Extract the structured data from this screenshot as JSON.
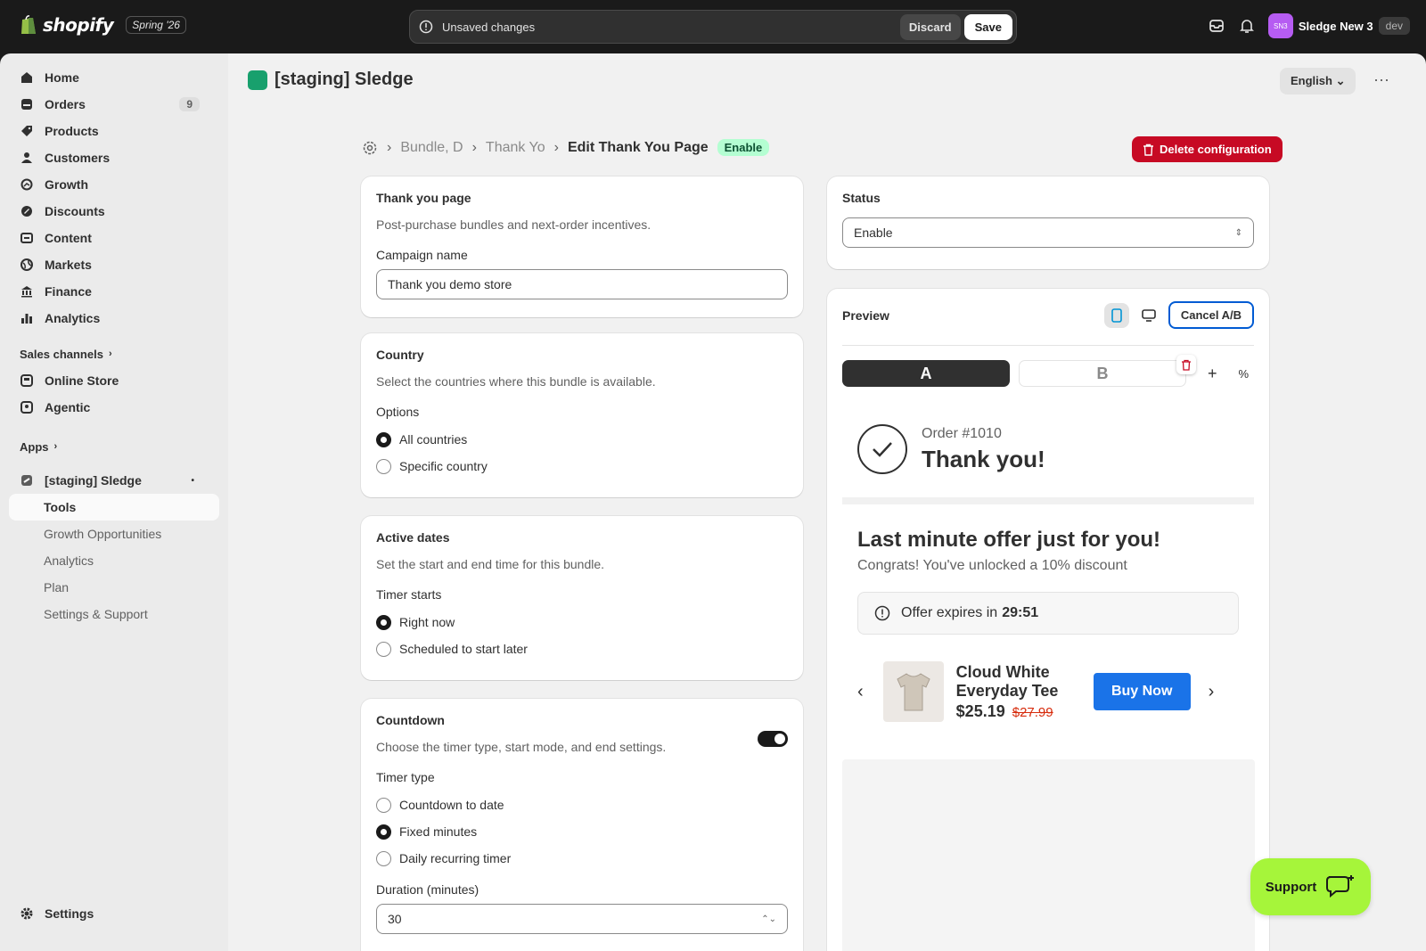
{
  "topbar": {
    "brand": "shopify",
    "edition": "Spring '26",
    "unsaved_text": "Unsaved changes",
    "discard_label": "Discard",
    "save_label": "Save",
    "avatar_initials": "SN3",
    "store_name": "Sledge New 3",
    "env_badge": "dev"
  },
  "sidebar": {
    "items": [
      {
        "label": "Home",
        "icon": "home-icon"
      },
      {
        "label": "Orders",
        "icon": "orders-icon",
        "badge": "9"
      },
      {
        "label": "Products",
        "icon": "tag-icon"
      },
      {
        "label": "Customers",
        "icon": "person-icon"
      },
      {
        "label": "Growth",
        "icon": "growth-icon"
      },
      {
        "label": "Discounts",
        "icon": "discount-icon"
      },
      {
        "label": "Content",
        "icon": "content-icon"
      },
      {
        "label": "Markets",
        "icon": "globe-icon"
      },
      {
        "label": "Finance",
        "icon": "bank-icon"
      },
      {
        "label": "Analytics",
        "icon": "bar-chart-icon"
      }
    ],
    "sales_channels_label": "Sales channels",
    "channels": [
      {
        "label": "Online Store",
        "icon": "store-icon"
      },
      {
        "label": "Agentic",
        "icon": "agentic-icon"
      }
    ],
    "apps_label": "Apps",
    "app_name": "[staging] Sledge",
    "app_subitems": [
      "Tools",
      "Growth Opportunities",
      "Analytics",
      "Plan",
      "Settings & Support"
    ],
    "settings_label": "Settings"
  },
  "header": {
    "app_title": "[staging] Sledge",
    "language": "English"
  },
  "breadcrumbs": {
    "crumb1": "Bundle, D",
    "crumb2": "Thank Yo",
    "current": "Edit Thank You Page",
    "status_pill": "Enable",
    "delete_label": "Delete configuration"
  },
  "cards": {
    "thankyou": {
      "title": "Thank you page",
      "subtitle": "Post-purchase bundles and next-order incentives.",
      "campaign_label": "Campaign name",
      "campaign_value": "Thank you demo store"
    },
    "country": {
      "title": "Country",
      "subtitle": "Select the countries where this bundle is available.",
      "options_label": "Options",
      "opt1": "All countries",
      "opt2": "Specific country"
    },
    "dates": {
      "title": "Active dates",
      "subtitle": "Set the start and end time for this bundle.",
      "timer_label": "Timer starts",
      "opt1": "Right now",
      "opt2": "Scheduled to start later"
    },
    "countdown": {
      "title": "Countdown",
      "subtitle": "Choose the timer type, start mode, and end settings.",
      "type_label": "Timer type",
      "opt1": "Countdown to date",
      "opt2": "Fixed minutes",
      "opt3": "Daily recurring timer",
      "duration_label": "Duration (minutes)",
      "duration_value": "30"
    },
    "status": {
      "title": "Status",
      "value": "Enable"
    }
  },
  "preview": {
    "title": "Preview",
    "cancel_ab": "Cancel A/B",
    "variant_a": "A",
    "variant_b": "B",
    "add": "+",
    "pct": "%",
    "order_no": "Order #1010",
    "thanks": "Thank you!",
    "offer_title": "Last minute offer just for you!",
    "offer_sub": "Congrats! You've unlocked a 10% discount",
    "expires_text": "Offer expires in",
    "expires_time": "29:51",
    "product_name": "Cloud White Everyday Tee",
    "price": "$25.19",
    "old_price": "$27.99",
    "buy_label": "Buy Now"
  },
  "support_label": "Support",
  "colors": {
    "accent_green": "#a6f53a",
    "delete_red": "#c70a24",
    "buy_blue": "#1a73e8"
  }
}
